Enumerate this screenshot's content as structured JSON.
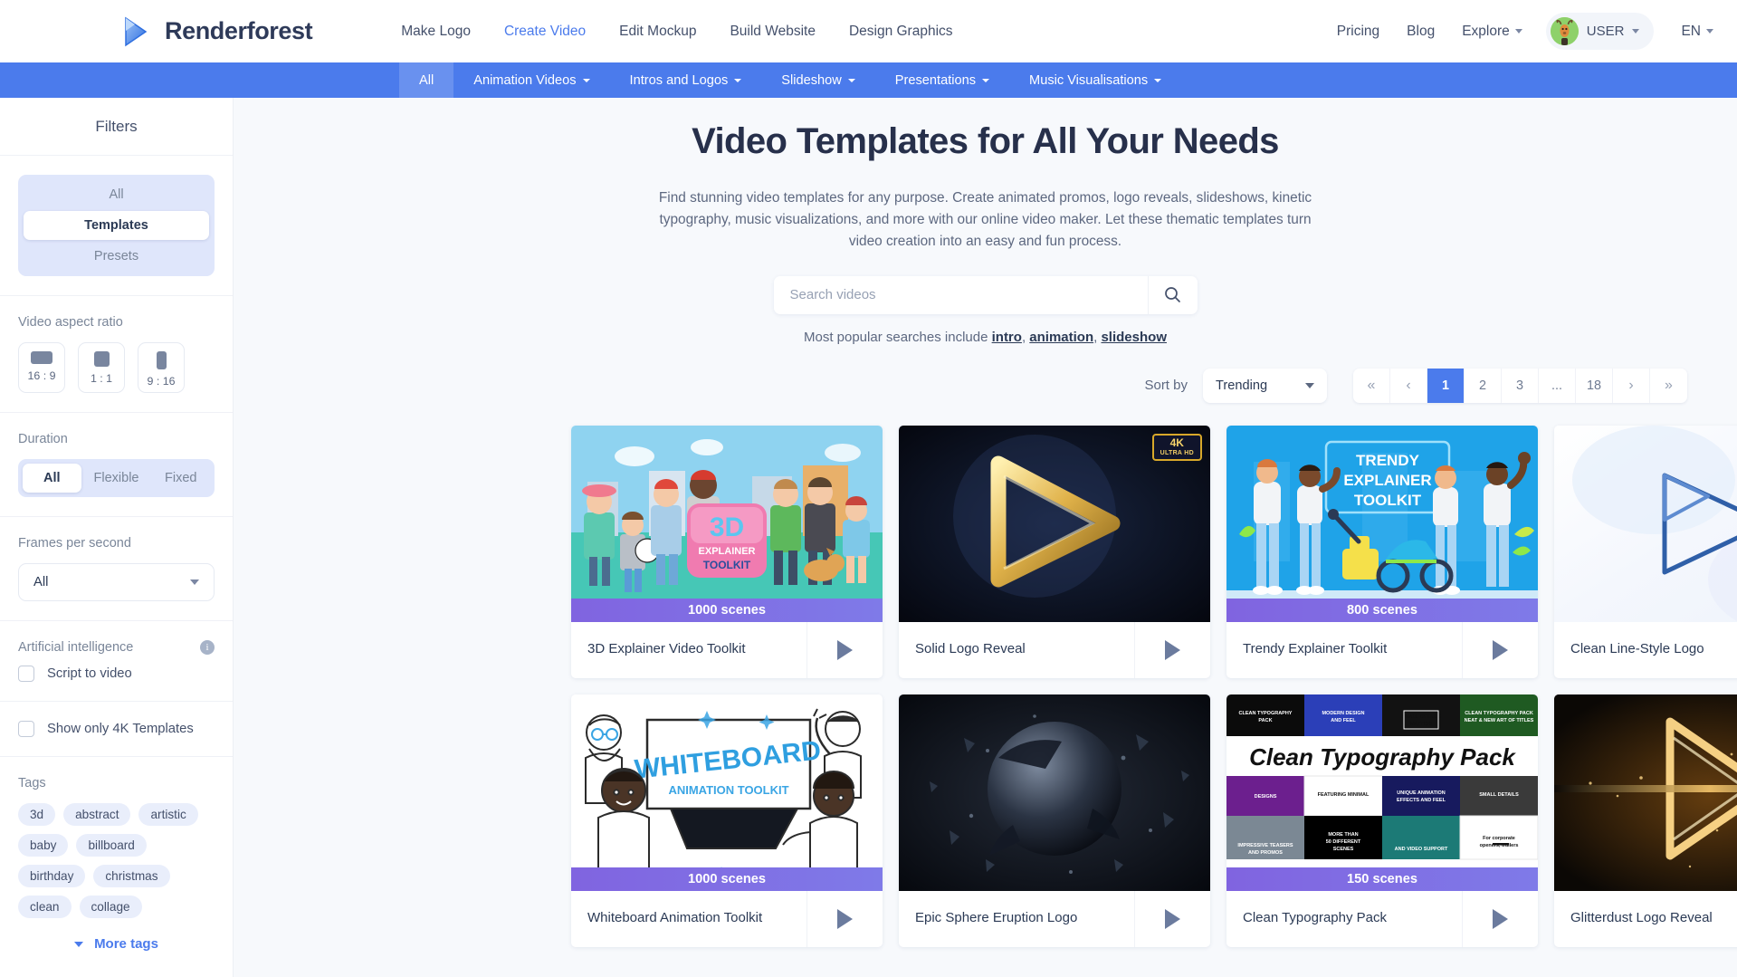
{
  "header": {
    "brand": "Renderforest",
    "nav": [
      {
        "label": "Make Logo",
        "active": false
      },
      {
        "label": "Create Video",
        "active": true
      },
      {
        "label": "Edit Mockup",
        "active": false
      },
      {
        "label": "Build Website",
        "active": false
      },
      {
        "label": "Design Graphics",
        "active": false
      }
    ],
    "right": [
      {
        "label": "Pricing",
        "caret": false
      },
      {
        "label": "Blog",
        "caret": false
      },
      {
        "label": "Explore",
        "caret": true
      }
    ],
    "user_label": "USER",
    "language": "EN"
  },
  "categories": [
    {
      "label": "All",
      "caret": false,
      "active": true
    },
    {
      "label": "Animation Videos",
      "caret": true,
      "active": false
    },
    {
      "label": "Intros and Logos",
      "caret": true,
      "active": false
    },
    {
      "label": "Slideshow",
      "caret": true,
      "active": false
    },
    {
      "label": "Presentations",
      "caret": true,
      "active": false
    },
    {
      "label": "Music Visualisations",
      "caret": true,
      "active": false
    }
  ],
  "sidebar": {
    "title": "Filters",
    "type_options": [
      {
        "label": "All",
        "selected": false
      },
      {
        "label": "Templates",
        "selected": true
      },
      {
        "label": "Presets",
        "selected": false
      }
    ],
    "aspect_ratio": {
      "label": "Video aspect ratio",
      "options": [
        {
          "label": "16 : 9",
          "shape": "g169"
        },
        {
          "label": "1 : 1",
          "shape": "g11"
        },
        {
          "label": "9 : 16",
          "shape": "g916"
        }
      ]
    },
    "duration": {
      "label": "Duration",
      "options": [
        {
          "label": "All",
          "selected": true
        },
        {
          "label": "Flexible",
          "selected": false
        },
        {
          "label": "Fixed",
          "selected": false
        }
      ]
    },
    "fps": {
      "label": "Frames per second",
      "value": "All"
    },
    "ai": {
      "label": "Artificial intelligence",
      "checkbox": "Script to video",
      "checked": false
    },
    "only4k": {
      "label": "Show only 4K Templates",
      "checked": false
    },
    "tags": {
      "label": "Tags",
      "items": [
        "3d",
        "abstract",
        "artistic",
        "baby",
        "billboard",
        "birthday",
        "christmas",
        "clean",
        "collage"
      ],
      "more_label": "More tags"
    }
  },
  "hero": {
    "title": "Video Templates for All Your Needs",
    "subtitle": "Find stunning video templates for any purpose. Create animated promos, logo reveals, slideshows, kinetic typography, music visualizations, and more with our online video maker. Let these thematic templates turn video creation into an easy and fun process.",
    "search_placeholder": "Search videos",
    "search_value": "",
    "popular_prefix": "Most popular searches include ",
    "popular_links": [
      "intro",
      "animation",
      "slideshow"
    ]
  },
  "toolbar": {
    "sort_label": "Sort by",
    "sort_value": "Trending",
    "pages": [
      {
        "label": "«",
        "type": "sym"
      },
      {
        "label": "‹",
        "type": "sym"
      },
      {
        "label": "1",
        "type": "cur"
      },
      {
        "label": "2",
        "type": "num"
      },
      {
        "label": "3",
        "type": "num"
      },
      {
        "label": "...",
        "type": "num"
      },
      {
        "label": "18",
        "type": "num"
      },
      {
        "label": "›",
        "type": "sym"
      },
      {
        "label": "»",
        "type": "sym"
      }
    ]
  },
  "cards": [
    {
      "title": "3D Explainer Video Toolkit",
      "scenes": "1000 scenes",
      "is4k": false,
      "art": "explainer3d"
    },
    {
      "title": "Solid Logo Reveal",
      "scenes": "",
      "is4k": true,
      "art": "goldlogo"
    },
    {
      "title": "Trendy Explainer Toolkit",
      "scenes": "800 scenes",
      "is4k": false,
      "art": "trendy"
    },
    {
      "title": "Clean Line-Style Logo",
      "scenes": "",
      "is4k": true,
      "art": "lineLogo"
    },
    {
      "title": "Whiteboard Animation Toolkit",
      "scenes": "1000 scenes",
      "is4k": false,
      "art": "whiteboard"
    },
    {
      "title": "Epic Sphere Eruption Logo",
      "scenes": "",
      "is4k": false,
      "art": "sphere"
    },
    {
      "title": "Clean Typography Pack",
      "scenes": "150 scenes",
      "is4k": false,
      "art": "typography"
    },
    {
      "title": "Glitterdust Logo Reveal",
      "scenes": "",
      "is4k": true,
      "art": "glitter"
    }
  ],
  "badge": {
    "line1": "4K",
    "line2": "ULTRA HD"
  },
  "colors": {
    "accent": "#4b7bec",
    "scenes_bar": "#8064e0",
    "badge_gold": "#d8a82a"
  }
}
